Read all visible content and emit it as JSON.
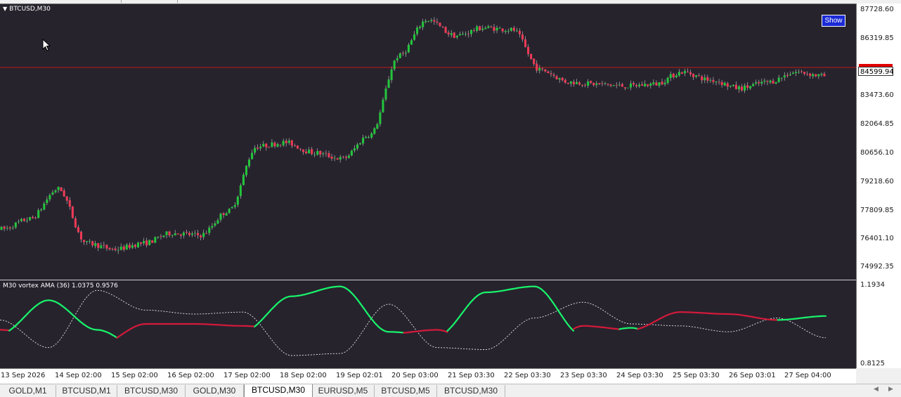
{
  "chart": {
    "symbol_title": "BTCUSD,M30",
    "indicator_title": "M30 vortex AMA (36) 1.0375 0.9576",
    "show_button": "Show",
    "bid_price": "84599.94",
    "price_levels": [
      "87728.60",
      "86319.85",
      "84599.94",
      "83473.60",
      "82064.85",
      "80656.10",
      "79218.60",
      "77809.85",
      "76401.10",
      "74992.35"
    ],
    "indicator_levels": [
      "1.1934",
      "0.8125"
    ],
    "time_labels": [
      "13 Sep 2026",
      "14 Sep 02:00",
      "15 Sep 02:00",
      "16 Sep 02:00",
      "17 Sep 02:00",
      "18 Sep 02:00",
      "19 Sep 02:01",
      "20 Sep 03:00",
      "21 Sep 03:30",
      "22 Sep 03:30",
      "23 Sep 03:30",
      "24 Sep 03:30",
      "25 Sep 03:30",
      "26 Sep 03:01",
      "27 Sep 04:00"
    ],
    "colors": {
      "background": "#26232d",
      "bull": "#24c43c",
      "bear": "#ef3a56",
      "wick": "#cfcfcf",
      "bid_line": "#c01818",
      "vortex_up": "#19f26a",
      "vortex_down": "#d21a3a",
      "vortex_aux": "#e8e8e8"
    }
  },
  "chart_data": {
    "type": "line",
    "title": "BTCUSD,M30",
    "x": [
      "13 Sep 2026",
      "14 Sep 02:00",
      "15 Sep 02:00",
      "16 Sep 02:00",
      "17 Sep 02:00",
      "18 Sep 02:00",
      "19 Sep 02:01",
      "20 Sep 03:00",
      "21 Sep 03:30",
      "22 Sep 03:30",
      "23 Sep 03:30",
      "24 Sep 03:30",
      "25 Sep 03:30",
      "26 Sep 03:01",
      "27 Sep 04:00"
    ],
    "price_ylim": [
      74600,
      88000
    ],
    "price_series": [
      76900,
      77400,
      78900,
      76200,
      75900,
      76200,
      76700,
      76600,
      77800,
      81000,
      81200,
      80700,
      80400,
      81600,
      85500,
      87300,
      86500,
      86900,
      86800,
      84800,
      84200,
      84100,
      84000,
      84100,
      84700,
      84300,
      83900,
      84200,
      84700,
      84500
    ],
    "indicator_ylim": [
      0.79,
      1.21
    ],
    "series": [
      {
        "values": [
          0.95,
          1.12,
          0.97,
          0.86,
          0.93,
          0.96,
          1.14,
          1.19,
          0.96,
          0.94,
          1.16,
          1.19,
          0.94,
          0.98,
          0.87,
          0.96,
          1.02,
          1.04
        ]
      },
      {
        "values": [
          0.97,
          0.94,
          0.89,
          1.0,
          1.0,
          0.99,
          0.97,
          0.86,
          0.95,
          0.97,
          0.87,
          0.83,
          0.99,
          0.97,
          1.06,
          1.05,
          1.02,
          0.95
        ]
      },
      {
        "values": [
          1.02,
          0.88,
          1.17,
          1.07,
          1.05,
          1.06,
          0.84,
          0.85,
          1.1,
          0.88,
          0.87,
          1.03,
          1.11,
          1.0,
          0.99,
          0.96,
          1.03,
          0.93
        ]
      }
    ]
  },
  "tabs": [
    {
      "label": "GOLD,M1",
      "active": false
    },
    {
      "label": "BTCUSD,M1",
      "active": false
    },
    {
      "label": "BTCUSD,M30",
      "active": false
    },
    {
      "label": "GOLD,M30",
      "active": false
    },
    {
      "label": "BTCUSD,M30",
      "active": true
    },
    {
      "label": "EURUSD,M5",
      "active": false
    },
    {
      "label": "BTCUSD,M5",
      "active": false
    },
    {
      "label": "BTCUSD,M30",
      "active": false
    }
  ],
  "icons": {
    "scroll_left": "chevron-left-icon",
    "scroll_right": "chevron-right-icon",
    "title_toggle": "triangle-down-icon",
    "pointer": "mouse-cursor-icon"
  }
}
